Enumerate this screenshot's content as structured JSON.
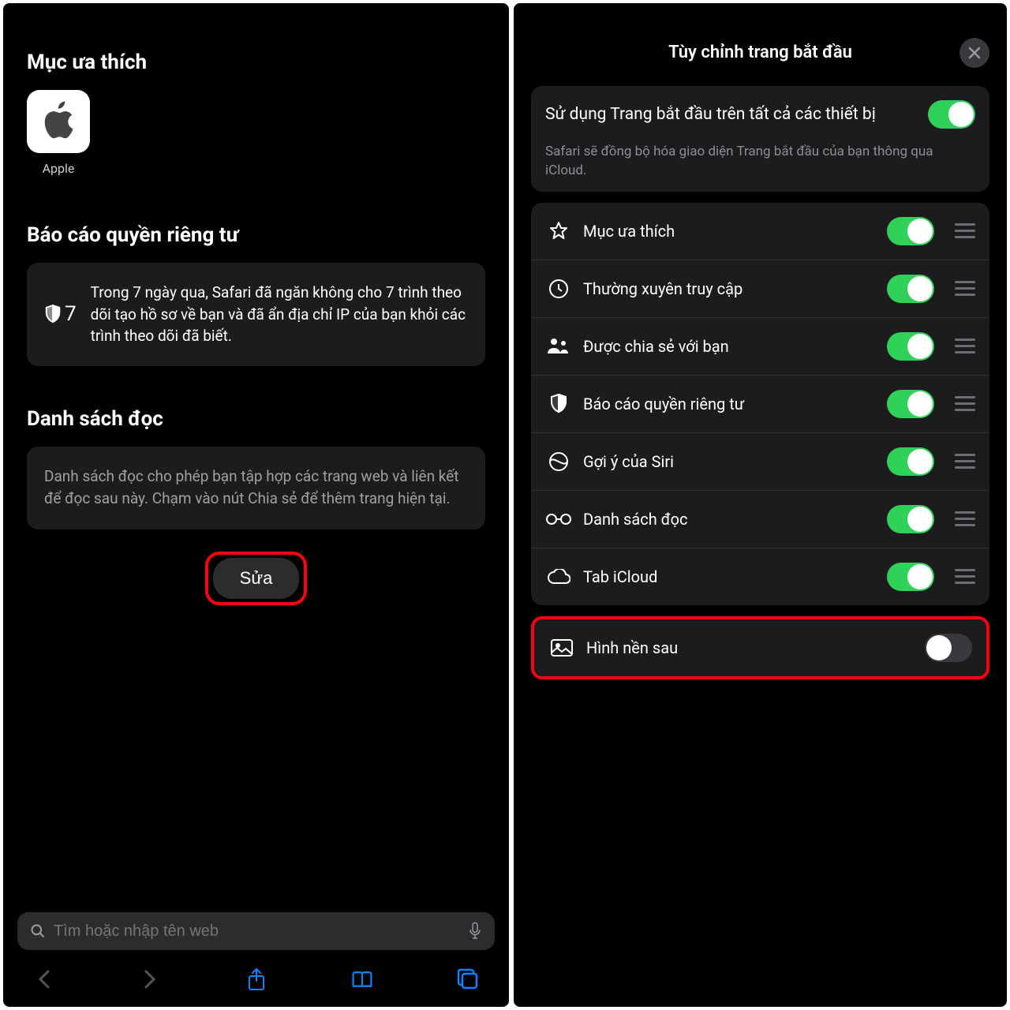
{
  "left": {
    "favorites": {
      "title": "Mục ưa thích",
      "items": [
        {
          "label": "Apple"
        }
      ]
    },
    "privacy": {
      "title": "Báo cáo quyền riêng tư",
      "count": "7",
      "text": "Trong 7 ngày qua, Safari đã ngăn không cho 7 trình theo dõi tạo hồ sơ về bạn và đã ẩn địa chỉ IP của bạn khỏi các trình theo dõi đã biết."
    },
    "readlist": {
      "title": "Danh sách đọc",
      "text": "Danh sách đọc cho phép bạn tập hợp các trang web và liên kết để đọc sau này. Chạm vào nút Chia sẻ để thêm trang hiện tại."
    },
    "edit_label": "Sửa",
    "search_placeholder": "Tìm hoặc nhập tên web"
  },
  "right": {
    "title": "Tùy chỉnh trang bắt đầu",
    "sync": {
      "label": "Sử dụng Trang bắt đầu trên tất cả các thiết bị",
      "on": true
    },
    "sync_hint": "Safari sẽ đồng bộ hóa giao diện Trang bắt đầu của bạn thông qua iCloud.",
    "options": [
      {
        "icon": "star",
        "label": "Mục ưa thích",
        "on": true
      },
      {
        "icon": "clock",
        "label": "Thường xuyên truy cập",
        "on": true
      },
      {
        "icon": "people",
        "label": "Được chia sẻ với bạn",
        "on": true
      },
      {
        "icon": "shield",
        "label": "Báo cáo quyền riêng tư",
        "on": true
      },
      {
        "icon": "siri",
        "label": "Gợi ý của Siri",
        "on": true
      },
      {
        "icon": "glasses",
        "label": "Danh sách đọc",
        "on": true
      },
      {
        "icon": "cloud",
        "label": "Tab iCloud",
        "on": true
      }
    ],
    "bg": {
      "label": "Hình nền sau",
      "on": false
    }
  }
}
